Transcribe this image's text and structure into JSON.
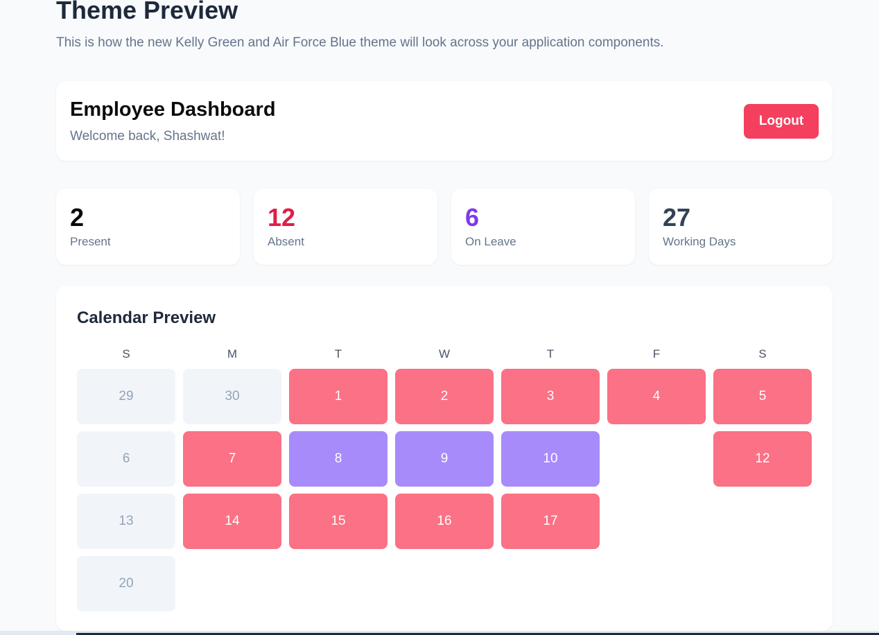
{
  "preview": {
    "title": "Theme Preview",
    "subtitle": "This is how the new Kelly Green and Air Force Blue theme will look across your application components."
  },
  "header": {
    "title": "Employee Dashboard",
    "welcome": "Welcome back, Shashwat!",
    "logout_label": "Logout"
  },
  "stats": [
    {
      "value": "2",
      "label": "Present",
      "color": "#0b0b0b"
    },
    {
      "value": "12",
      "label": "Absent",
      "color": "#e11d48"
    },
    {
      "value": "6",
      "label": "On Leave",
      "color": "#7c3aed"
    },
    {
      "value": "27",
      "label": "Working Days",
      "color": "#334155"
    }
  ],
  "calendar": {
    "title": "Calendar Preview",
    "weekdays": [
      "S",
      "M",
      "T",
      "W",
      "T",
      "F",
      "S"
    ],
    "days": [
      {
        "label": "29",
        "status": "past"
      },
      {
        "label": "30",
        "status": "past"
      },
      {
        "label": "1",
        "status": "absent"
      },
      {
        "label": "2",
        "status": "absent"
      },
      {
        "label": "3",
        "status": "absent"
      },
      {
        "label": "4",
        "status": "absent"
      },
      {
        "label": "5",
        "status": "absent"
      },
      {
        "label": "6",
        "status": "past"
      },
      {
        "label": "7",
        "status": "absent"
      },
      {
        "label": "8",
        "status": "leave"
      },
      {
        "label": "9",
        "status": "leave"
      },
      {
        "label": "10",
        "status": "leave"
      },
      {
        "label": "",
        "status": "blank"
      },
      {
        "label": "12",
        "status": "absent"
      },
      {
        "label": "13",
        "status": "past"
      },
      {
        "label": "14",
        "status": "absent"
      },
      {
        "label": "15",
        "status": "absent"
      },
      {
        "label": "16",
        "status": "absent"
      },
      {
        "label": "17",
        "status": "absent"
      },
      {
        "label": "",
        "status": "blank"
      },
      {
        "label": "",
        "status": "blank"
      },
      {
        "label": "20",
        "status": "past"
      }
    ]
  },
  "colors": {
    "absent": "#fb7185",
    "leave": "#a78bfa",
    "past": "#f1f5f9",
    "logout": "#f43f5e"
  }
}
